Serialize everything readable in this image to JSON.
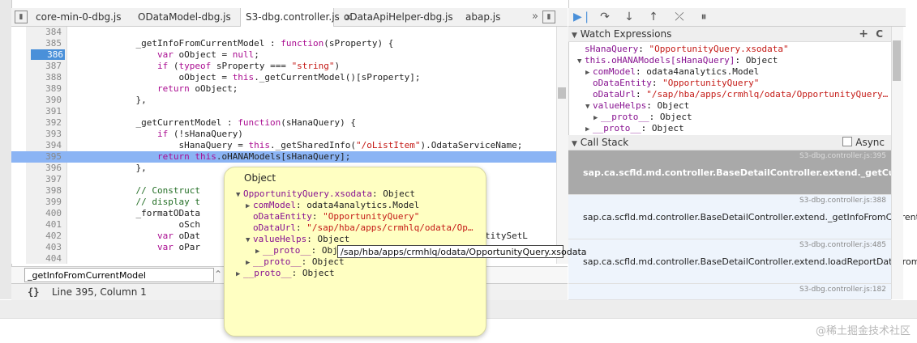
{
  "tabs": [
    {
      "label": "core-min-0-dbg.js"
    },
    {
      "label": "ODataModel-dbg.js"
    },
    {
      "label": "S3-dbg.controller.js",
      "active": true
    },
    {
      "label": "oDataApiHelper-dbg.js"
    },
    {
      "label": "abap.js"
    }
  ],
  "tab_overflow": "»",
  "close_glyph": "×",
  "code": {
    "lines": [
      {
        "n": "384",
        "code": ""
      },
      {
        "n": "385",
        "code": "            _getInfoFromCurrentModel : function(sProperty) {"
      },
      {
        "n": "386",
        "code": "                var oObject = null;",
        "breakpoint": true
      },
      {
        "n": "387",
        "code": "                if (typeof sProperty === \"string\")"
      },
      {
        "n": "388",
        "code": "                    oObject = this._getCurrentModel()[sProperty];"
      },
      {
        "n": "389",
        "code": "                return oObject;"
      },
      {
        "n": "390",
        "code": "            },"
      },
      {
        "n": "391",
        "code": ""
      },
      {
        "n": "392",
        "code": "            _getCurrentModel : function(sHanaQuery) {"
      },
      {
        "n": "393",
        "code": "                if (!sHanaQuery)"
      },
      {
        "n": "394",
        "code": "                    sHanaQuery = this._getSharedInfo(\"/oListItem\").OdataServiceName;"
      },
      {
        "n": "395",
        "code": "                return this.oHANAModels[sHanaQuery];",
        "current": true
      },
      {
        "n": "396",
        "code": "            },"
      },
      {
        "n": "397",
        "code": ""
      },
      {
        "n": "398",
        "code": "            // Construct"
      },
      {
        "n": "399",
        "code": "            // display t"
      },
      {
        "n": "400",
        "code": "            _formatOData"
      },
      {
        "n": "401",
        "code": "                    oSch"
      },
      {
        "n": "402",
        "code": "                var oDat                                                , aEntitySetL"
      },
      {
        "n": "403",
        "code": "                var oPar"
      },
      {
        "n": "404",
        "code": ""
      }
    ]
  },
  "search": {
    "value": "_getInfoFromCurrentModel"
  },
  "status": {
    "braces": "{}",
    "position": "Line 395, Column 1"
  },
  "watch": {
    "title": "Watch Expressions",
    "add_icon": "+",
    "refresh_icon": "C",
    "items": [
      {
        "indent": 0,
        "tri": "",
        "key": "sHanaQuery",
        "sep": ": ",
        "val": "\"OpportunityQuery.xsodata\"",
        "str": true
      },
      {
        "indent": 0,
        "tri": "▼",
        "key": "this.oHANAModels[sHanaQuery]",
        "sep": ": ",
        "val": "Object",
        "str": false
      },
      {
        "indent": 1,
        "tri": "▶",
        "key": "comModel",
        "sep": ": ",
        "val": "odata4analytics.Model",
        "str": false
      },
      {
        "indent": 1,
        "tri": "",
        "key": "oDataEntity",
        "sep": ": ",
        "val": "\"OpportunityQuery\"",
        "str": true
      },
      {
        "indent": 1,
        "tri": "",
        "key": "oDataUrl",
        "sep": ": ",
        "val": "\"/sap/hba/apps/crmhlq/odata/OpportunityQuery…",
        "str": true
      },
      {
        "indent": 1,
        "tri": "▼",
        "key": "valueHelps",
        "sep": ": ",
        "val": "Object",
        "str": false
      },
      {
        "indent": 2,
        "tri": "▶",
        "key": "__proto__",
        "sep": ": ",
        "val": "Object",
        "str": false
      },
      {
        "indent": 1,
        "tri": "▶",
        "key": "__proto__",
        "sep": ": ",
        "val": "Object",
        "str": false
      }
    ]
  },
  "callstack": {
    "title": "Call Stack",
    "async_label": "Async",
    "frames": [
      {
        "file": "S3-dbg.controller.js:395",
        "fn": "sap.ca.scfld.md.controller.BaseDetailController.extend._getCurrentModel",
        "selected": true
      },
      {
        "file": "S3-dbg.controller.js:388",
        "fn": "sap.ca.scfld.md.controller.BaseDetailController.extend._getInfoFromCurrentModel",
        "selected": false
      },
      {
        "file": "S3-dbg.controller.js:485",
        "fn": "sap.ca.scfld.md.controller.BaseDetailController.extend.loadReportDataFromHana",
        "selected": false
      },
      {
        "file": "S3-dbg.controller.js:182",
        "fn": "",
        "selected": false
      }
    ]
  },
  "popover": {
    "title": "Object",
    "lines": [
      {
        "indent": 0,
        "tri": "▼",
        "key": "OpportunityQuery.xsodata",
        "sep": ": ",
        "val": "Object",
        "str": false
      },
      {
        "indent": 1,
        "tri": "▶",
        "key": "comModel",
        "sep": ": ",
        "val": "odata4analytics.Model",
        "str": false
      },
      {
        "indent": 1,
        "tri": "",
        "key": "oDataEntity",
        "sep": ": ",
        "val": "\"OpportunityQuery\"",
        "str": true
      },
      {
        "indent": 1,
        "tri": "",
        "key": "oDataUrl",
        "sep": ": ",
        "val": "\"/sap/hba/apps/crmhlq/odata/Op…",
        "str": true
      },
      {
        "indent": 1,
        "tri": "▼",
        "key": "valueHelps",
        "sep": ": ",
        "val": "Object",
        "str": false
      },
      {
        "indent": 2,
        "tri": "▶",
        "key": "__proto__",
        "sep": ": ",
        "val": "Obj",
        "str": false
      },
      {
        "indent": 1,
        "tri": "▶",
        "key": "__proto__",
        "sep": ": ",
        "val": "Object",
        "str": false
      },
      {
        "indent": 0,
        "tri": "▶",
        "key": "__proto__",
        "sep": ": ",
        "val": "Object",
        "str": false
      }
    ],
    "tooltip": "/sap/hba/apps/crmhlq/odata/OpportunityQuery.xsodata"
  },
  "watermark": "@稀土掘金技术社区",
  "colors": {
    "accent": "#4a90d9",
    "current_line": "#8bb4f4",
    "popover_bg": "#ffffc2"
  }
}
